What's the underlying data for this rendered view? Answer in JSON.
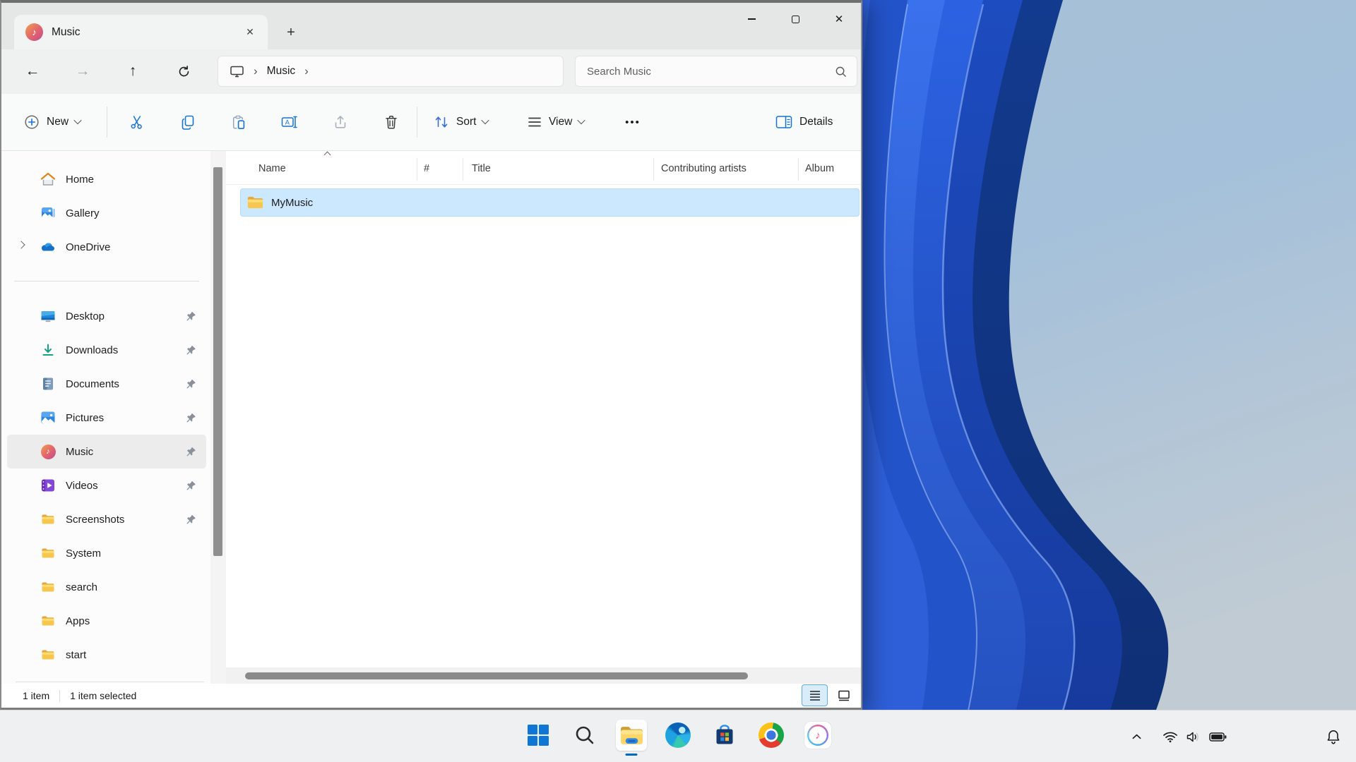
{
  "glyphs": {
    "note": "♪",
    "close": "✕",
    "plus": "+",
    "minimize": "–",
    "more": "•••",
    "chevron_right": "›",
    "back_arrow": "←",
    "forward_arrow": "→",
    "up_arrow": "↑"
  },
  "titlebar": {
    "tab_title": "Music"
  },
  "navbar": {
    "breadcrumb_location": "Music",
    "search_placeholder": "Search Music"
  },
  "toolbar": {
    "new_label": "New",
    "sort_label": "Sort",
    "view_label": "View",
    "details_label": "Details"
  },
  "sidebar": {
    "items": [
      {
        "label": "Home",
        "icon": "home-icon",
        "pinned": false
      },
      {
        "label": "Gallery",
        "icon": "gallery-icon",
        "pinned": false
      },
      {
        "label": "OneDrive",
        "icon": "onedrive-icon",
        "pinned": false,
        "expandable": true
      },
      {
        "label": "Desktop",
        "icon": "desktop-icon",
        "pinned": true
      },
      {
        "label": "Downloads",
        "icon": "downloads-icon",
        "pinned": true
      },
      {
        "label": "Documents",
        "icon": "documents-icon",
        "pinned": true
      },
      {
        "label": "Pictures",
        "icon": "pictures-icon",
        "pinned": true
      },
      {
        "label": "Music",
        "icon": "music-icon",
        "pinned": true,
        "selected": true
      },
      {
        "label": "Videos",
        "icon": "videos-icon",
        "pinned": true
      },
      {
        "label": "Screenshots",
        "icon": "folder-icon",
        "pinned": true
      },
      {
        "label": "System",
        "icon": "folder-icon",
        "pinned": false
      },
      {
        "label": "search",
        "icon": "folder-icon",
        "pinned": false
      },
      {
        "label": "Apps",
        "icon": "folder-icon",
        "pinned": false
      },
      {
        "label": "start",
        "icon": "folder-icon",
        "pinned": false
      }
    ]
  },
  "file_list": {
    "columns": [
      {
        "label": "Name",
        "sorted": "ascending"
      },
      {
        "label": "#"
      },
      {
        "label": "Title"
      },
      {
        "label": "Contributing artists"
      },
      {
        "label": "Album"
      }
    ],
    "rows": [
      {
        "name": "MyMusic",
        "type": "folder",
        "selected": true
      }
    ]
  },
  "status_bar": {
    "item_count": "1 item",
    "selection_count": "1 item selected"
  },
  "taskbar": {
    "buttons": [
      {
        "name": "start"
      },
      {
        "name": "search"
      },
      {
        "name": "file-explorer",
        "active": true
      },
      {
        "name": "edge"
      },
      {
        "name": "microsoft-store"
      },
      {
        "name": "chrome"
      },
      {
        "name": "itunes"
      }
    ]
  },
  "colors": {
    "accent": "#0067c0",
    "selection_bg": "#cce8ff",
    "sidebar_selected_bg": "#ececec"
  }
}
